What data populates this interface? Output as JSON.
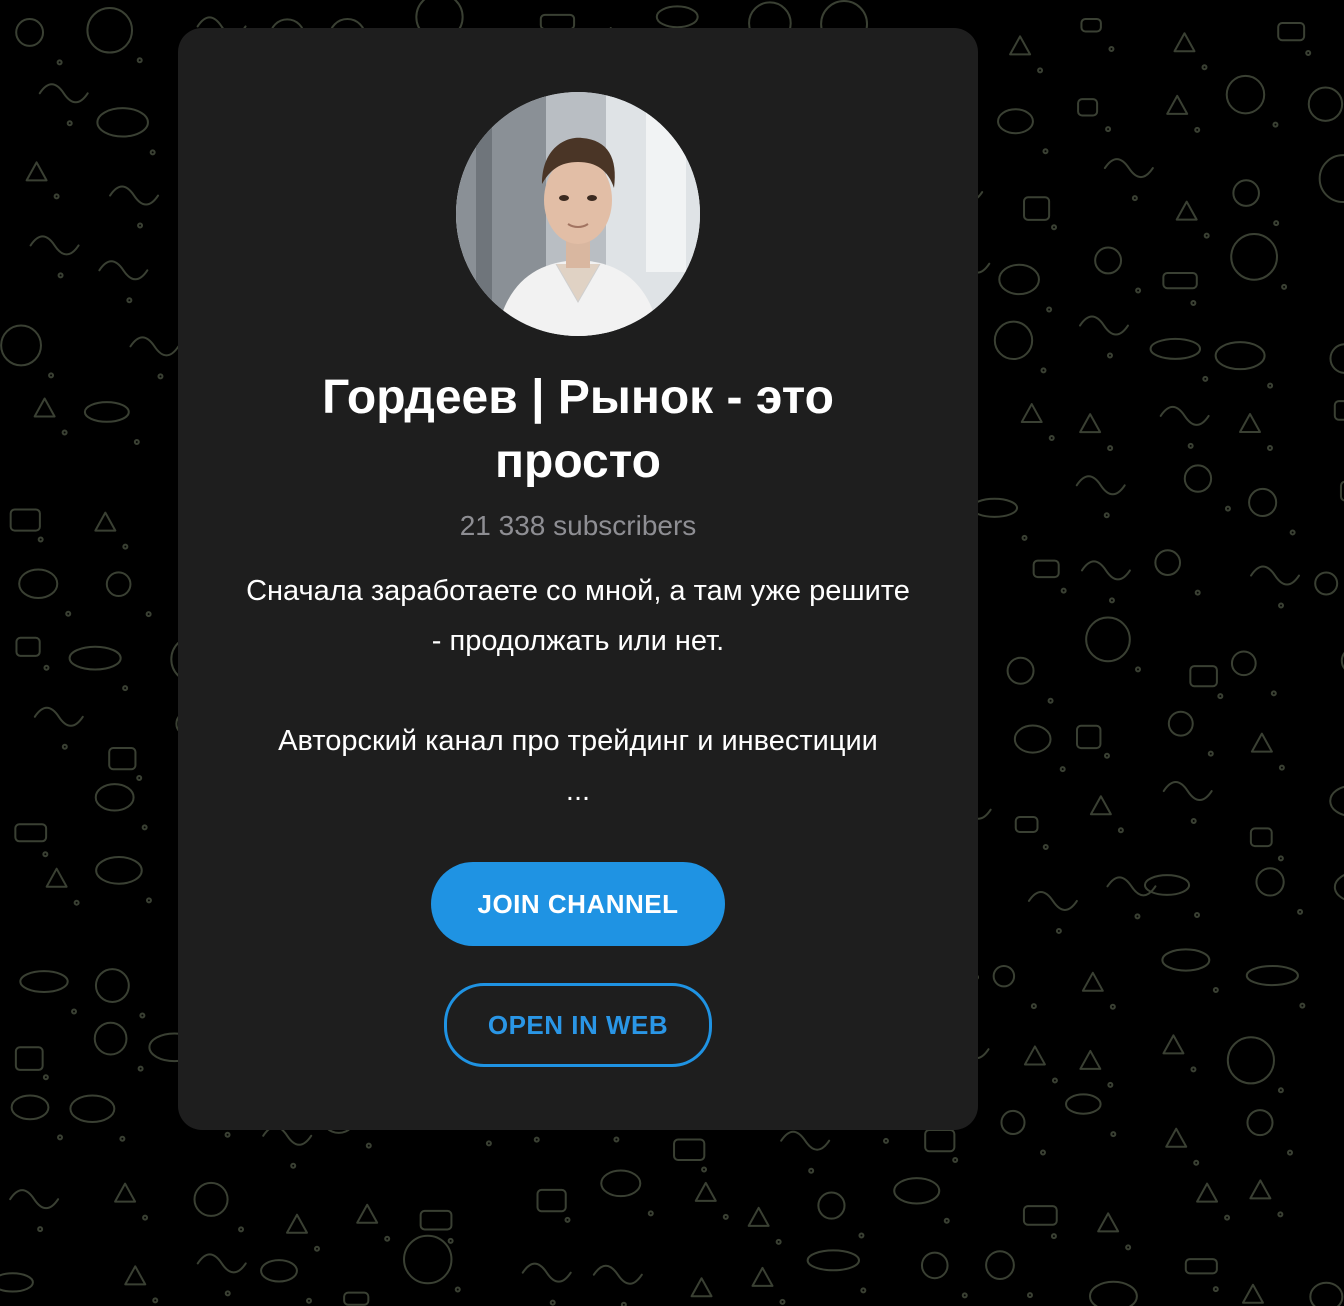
{
  "channel": {
    "title": "Гордеев | Рынок - это просто",
    "subscribers": "21 338 subscribers",
    "description_lines": [
      "Сначала заработаете со мной, а там уже решите",
      "- продолжать или нет.",
      "",
      "Авторский канал про трейдинг и инвестиции",
      "..."
    ],
    "avatar_icon": "channel-avatar-photo"
  },
  "actions": {
    "join_label": "JOIN CHANNEL",
    "web_label": "OPEN IN WEB"
  },
  "colors": {
    "background": "#000000",
    "card": "#1e1e1e",
    "accent": "#1f93e3",
    "pattern": "#3a4033",
    "muted_text": "#8e8e93"
  }
}
